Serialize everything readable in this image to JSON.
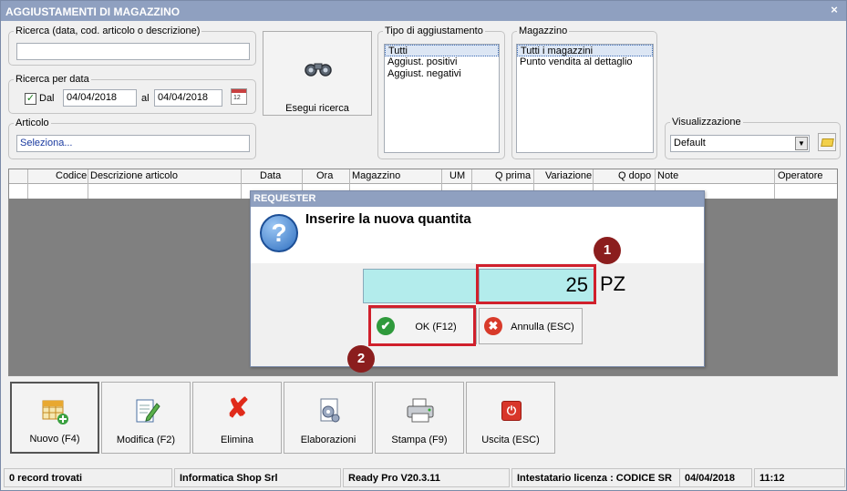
{
  "window": {
    "title": "AGGIUSTAMENTI DI MAGAZZINO",
    "close_glyph": "×"
  },
  "search": {
    "legend": "Ricerca (data, cod. articolo o descrizione)",
    "value": ""
  },
  "date_search": {
    "legend": "Ricerca per data",
    "checkbox_label": "Dal",
    "checked": true,
    "from": "04/04/2018",
    "to_label": "al",
    "to": "04/04/2018"
  },
  "article": {
    "legend": "Articolo",
    "value": "Seleziona..."
  },
  "run_search": {
    "label": "Esegui ricerca",
    "icon": "binoculars-icon"
  },
  "adjust_type": {
    "legend": "Tipo di aggiustamento",
    "items": [
      "Tutti",
      "Aggiust. positivi",
      "Aggiust. negativi"
    ],
    "selected": 0
  },
  "warehouse": {
    "legend": "Magazzino",
    "items": [
      "Tutti i magazzini",
      "Punto vendita al dettaglio"
    ],
    "selected": 0
  },
  "view": {
    "legend": "Visualizzazione",
    "value": "Default"
  },
  "table": {
    "columns": [
      "Codice",
      "Descrizione articolo",
      "Data",
      "Ora",
      "Magazzino",
      "UM",
      "Q prima",
      "Variazione",
      "Q dopo",
      "Note",
      "Operatore"
    ]
  },
  "dialog": {
    "title": "REQUESTER",
    "message": "Inserire la nuova quantita",
    "quantity": "25",
    "unit": "PZ",
    "ok_label": "OK (F12)",
    "cancel_label": "Annulla (ESC)"
  },
  "markers": {
    "one": "1",
    "two": "2"
  },
  "toolbar": {
    "new": "Nuovo (F4)",
    "edit": "Modifica (F2)",
    "delete": "Elimina",
    "process": "Elaborazioni",
    "print": "Stampa (F9)",
    "exit": "Uscita (ESC)"
  },
  "status": {
    "records": "0 record trovati",
    "company": "Informatica Shop Srl",
    "version": "Ready Pro V20.3.11",
    "license": "Intestatario licenza : CODICE SR",
    "date": "04/04/2018",
    "time": "11:12"
  },
  "colors": {
    "titlebar": "#8fa0c0",
    "highlight": "#d0202c",
    "qty_field": "#b3ecec",
    "marker": "#8b1e1e"
  }
}
